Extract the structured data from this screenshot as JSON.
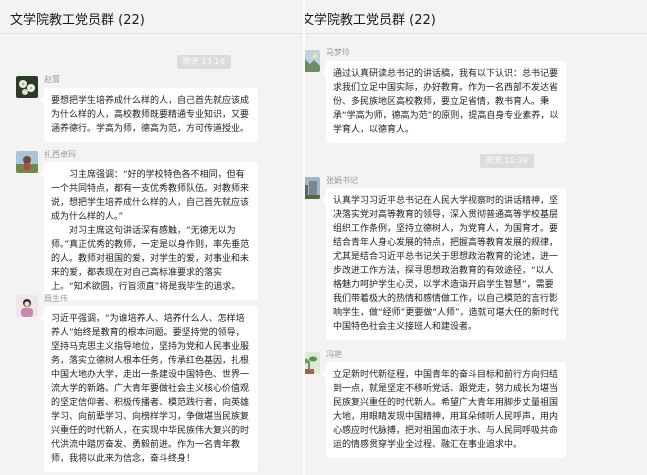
{
  "colors": {
    "panel_bg": "#f3f3f3",
    "bubble_bg": "#ffffff",
    "timestamp_bg": "#dcdcdc",
    "name_text": "#9a9a9a"
  },
  "left": {
    "title": "文学院教工党员群 (22)",
    "timestamp": "昨天 13:14",
    "messages": [
      {
        "name": "赵蕾",
        "avatar_icon": "flower-avatar-icon",
        "paragraphs": [
          "要想把学生培养成什么样的人，自己首先就应该成为什么样的人，高校教师既要精通专业知识，又要涵养德行。学高为师，德高为范，方可传道授业。"
        ]
      },
      {
        "name": "扎西卓玛",
        "avatar_icon": "photo-avatar-icon",
        "paragraphs": [
          "习主席强调：“好的学校特色各不相同，但有一个共同特点，都有一支优秀教师队伍。对教师来说，想把学生培养成什么样的人，自己首先就应该成为什么样的人。”",
          "对习主席这句讲话深有感触，“无德无以为师。”真正优秀的教师，一定是以身作则，率先垂范的人。教师对祖国的爱，对学生的爱，对事业和未来的爱，都表现在对自己高标准要求的落实上。“知术欲圆，行旨须直”将是我毕生的追求。"
        ]
      },
      {
        "name": "聂生伟",
        "avatar_icon": "portrait-avatar-icon",
        "paragraphs": [
          "习近平强调，“为谁培养人、培养什么人、怎样培养人”始终是教育的根本问题。要坚持党的领导，坚持马克思主义指导地位，坚持为党和人民事业服务，落实立德树人根本任务，传承红色基因，扎根中国大地办大学，走出一条建设中国特色、世界一流大学的新路。广大青年要做社会主义核心价值观的坚定信仰者、积极传播者、模范践行者，向英雄学习、向前辈学习、向榜样学习，争做堪当民族复兴重任的时代新人，在实现中华民族伟大复兴的时代洪流中踏厉奋发、勇毅前进。作为一名青年教师，我将以此来为信念，奋斗终身！"
        ]
      }
    ]
  },
  "right": {
    "title": "文学院教工党员群 (22)",
    "timestamp": "昨天 10:39",
    "messages": [
      {
        "name": "马梦玲",
        "avatar_icon": "landscape-avatar-icon",
        "paragraphs": [
          "通过认真研读总书记的讲话稿，我有以下认识：总书记要求我们立足中国实际，办好教育。作为一名西部不发达省份、多民族地区高校教师，要立足省情，教书育人。秉承“学高为师，德高为范”的原则，提高自身专业素养，以学育人，以德育人。"
        ]
      },
      {
        "name": "张娟书记",
        "avatar_icon": "building-avatar-icon",
        "paragraphs": [
          "认真学习习近平总书记在人民大学视察时的讲话精神，坚决落实党对高等教育的领导，深入贯彻普通高等学校基层组织工作条例，坚持立德树人，为党育人，为国育才。要结合青年人身心发展的特点，把握高等教育发展的规律，尤其是结合习近平总书记关于思想政治教育的论述，进一步改进工作方法，探寻思想政治教育的有效途径，“以人格魅力呵护学生心灵，以学术造诣开启学生智慧”，需要我们带着极大的热情和感情做工作，以自己模范的言行影响学生，做“经师”更要做“人师”，造就可堪大任的新时代中国特色社会主义接班人和建设者。"
        ]
      },
      {
        "name": "冯艳",
        "avatar_icon": "plant-avatar-icon",
        "paragraphs": [
          "立足新时代新征程，中国青年的奋斗目标和前行方向归结到一点，就是坚定不移听党话、跟党走，努力成长为堪当民族复兴重任的时代新人。希望广大青年用脚步丈量祖国大地，用眼睛发现中国精神，用耳朵倾听人民呼声，用内心感应时代脉搏，把对祖国血浓于水、与人民同呼吸共命运的情感贯穿学业全过程、融汇在事业追求中。"
        ]
      }
    ]
  }
}
